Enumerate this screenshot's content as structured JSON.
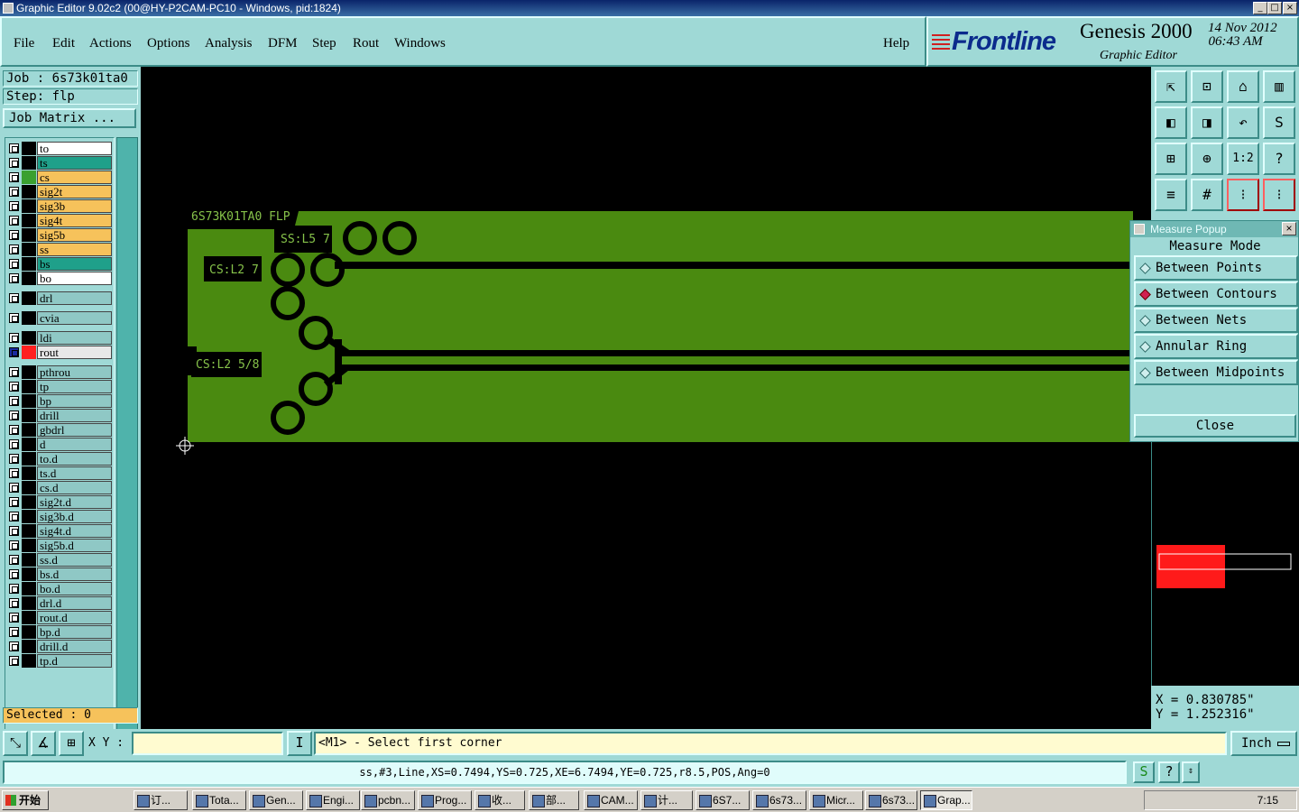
{
  "window": {
    "title": "Graphic Editor 9.02c2 (00@HY-P2CAM-PC10 - Windows, pid:1824)",
    "minimize": "_",
    "maximize": "□",
    "close": "×"
  },
  "menu": [
    "File",
    "Edit",
    "Actions",
    "Options",
    "Analysis",
    "DFM",
    "Step",
    "Rout",
    "Windows"
  ],
  "help_label": "Help",
  "logo": {
    "brand": "Frontline",
    "product": "Genesis 2000",
    "subtitle": "Graphic Editor",
    "date": "14 Nov 2012",
    "time": "06:43 AM"
  },
  "job": "Job : 6s73k01ta0",
  "step": "Step: flp",
  "job_matrix": "Job Matrix ...",
  "layers": [
    {
      "name": "to",
      "color": "#ffffff",
      "swatch": "#000000"
    },
    {
      "name": "ts",
      "color": "#1fa08a",
      "swatch": "#000000"
    },
    {
      "name": "cs",
      "color": "#f6c25b",
      "swatch": "#3aa030"
    },
    {
      "name": "sig2t",
      "color": "#f6c25b",
      "swatch": "#000000"
    },
    {
      "name": "sig3b",
      "color": "#f6c25b",
      "swatch": "#000000"
    },
    {
      "name": "sig4t",
      "color": "#f6c25b",
      "swatch": "#000000"
    },
    {
      "name": "sig5b",
      "color": "#f6c25b",
      "swatch": "#000000"
    },
    {
      "name": "ss",
      "color": "#f6c25b",
      "swatch": "#000000"
    },
    {
      "name": "bs",
      "color": "#1fa08a",
      "swatch": "#000000"
    },
    {
      "name": "bo",
      "color": "#ffffff",
      "swatch": "#000000"
    },
    {
      "name": "drl",
      "color": "#8fc8c5",
      "swatch": "#000000"
    },
    {
      "name": "cvia",
      "color": "#8fc8c5",
      "swatch": "#000000"
    },
    {
      "name": "ldi",
      "color": "#8fc8c5",
      "swatch": "#000000"
    },
    {
      "name": "rout",
      "color": "#e8e8e8",
      "swatch": "#ff2020"
    },
    {
      "name": "pthrou",
      "color": "#8fc8c5",
      "swatch": "#000000"
    },
    {
      "name": "tp",
      "color": "#8fc8c5",
      "swatch": "#000000"
    },
    {
      "name": "bp",
      "color": "#8fc8c5",
      "swatch": "#000000"
    },
    {
      "name": "drill",
      "color": "#8fc8c5",
      "swatch": "#000000"
    },
    {
      "name": "gbdrl",
      "color": "#8fc8c5",
      "swatch": "#000000"
    },
    {
      "name": "d",
      "color": "#8fc8c5",
      "swatch": "#000000"
    },
    {
      "name": "to.d",
      "color": "#8fc8c5",
      "swatch": "#000000"
    },
    {
      "name": "ts.d",
      "color": "#8fc8c5",
      "swatch": "#000000"
    },
    {
      "name": "cs.d",
      "color": "#8fc8c5",
      "swatch": "#000000"
    },
    {
      "name": "sig2t.d",
      "color": "#8fc8c5",
      "swatch": "#000000"
    },
    {
      "name": "sig3b.d",
      "color": "#8fc8c5",
      "swatch": "#000000"
    },
    {
      "name": "sig4t.d",
      "color": "#8fc8c5",
      "swatch": "#000000"
    },
    {
      "name": "sig5b.d",
      "color": "#8fc8c5",
      "swatch": "#000000"
    },
    {
      "name": "ss.d",
      "color": "#8fc8c5",
      "swatch": "#000000"
    },
    {
      "name": "bs.d",
      "color": "#8fc8c5",
      "swatch": "#000000"
    },
    {
      "name": "bo.d",
      "color": "#8fc8c5",
      "swatch": "#000000"
    },
    {
      "name": "drl.d",
      "color": "#8fc8c5",
      "swatch": "#000000"
    },
    {
      "name": "rout.d",
      "color": "#8fc8c5",
      "swatch": "#000000"
    },
    {
      "name": "bp.d",
      "color": "#8fc8c5",
      "swatch": "#000000"
    },
    {
      "name": "drill.d",
      "color": "#8fc8c5",
      "swatch": "#000000"
    },
    {
      "name": "tp.d",
      "color": "#8fc8c5",
      "swatch": "#000000"
    }
  ],
  "selected": "Selected : 0",
  "canvas": {
    "board_color": "#4a8a10",
    "label_main": "6S73K01TA0 FLP",
    "label_ss": "SS:L5 7",
    "label_cs1": "CS:L2 7",
    "label_cs2": "CS:L2 5/8"
  },
  "measure": {
    "title": "Measure Popup",
    "close_x": "×",
    "mode_label": "Measure Mode",
    "options": [
      "Between Points",
      "Between Contours",
      "Between Nets",
      "Annular Ring",
      "Between Midpoints"
    ],
    "selected_option": "Between Contours",
    "close": "Close"
  },
  "coords": {
    "x": "X = 0.830785\"",
    "y": "Y = 1.252316\""
  },
  "cmd": {
    "xy_label": "X Y :",
    "xy_value": "",
    "prompt": "<M1> - Select first corner",
    "unit": "Inch"
  },
  "status": "ss,#3,Line,XS=0.7494,YS=0.725,XE=6.7494,YE=0.725,r8.5,POS,Ang=0",
  "taskbar": {
    "start": "开始",
    "tasks": [
      "订...",
      "Tota...",
      "Gen...",
      "Engi...",
      "pcbn...",
      "Prog...",
      "收...",
      "部...",
      "CAM...",
      "计...",
      "6S7...",
      "6s73...",
      "Micr...",
      "6s73...",
      "Grap..."
    ],
    "active_task": "Grap...",
    "clock": "7:15"
  }
}
